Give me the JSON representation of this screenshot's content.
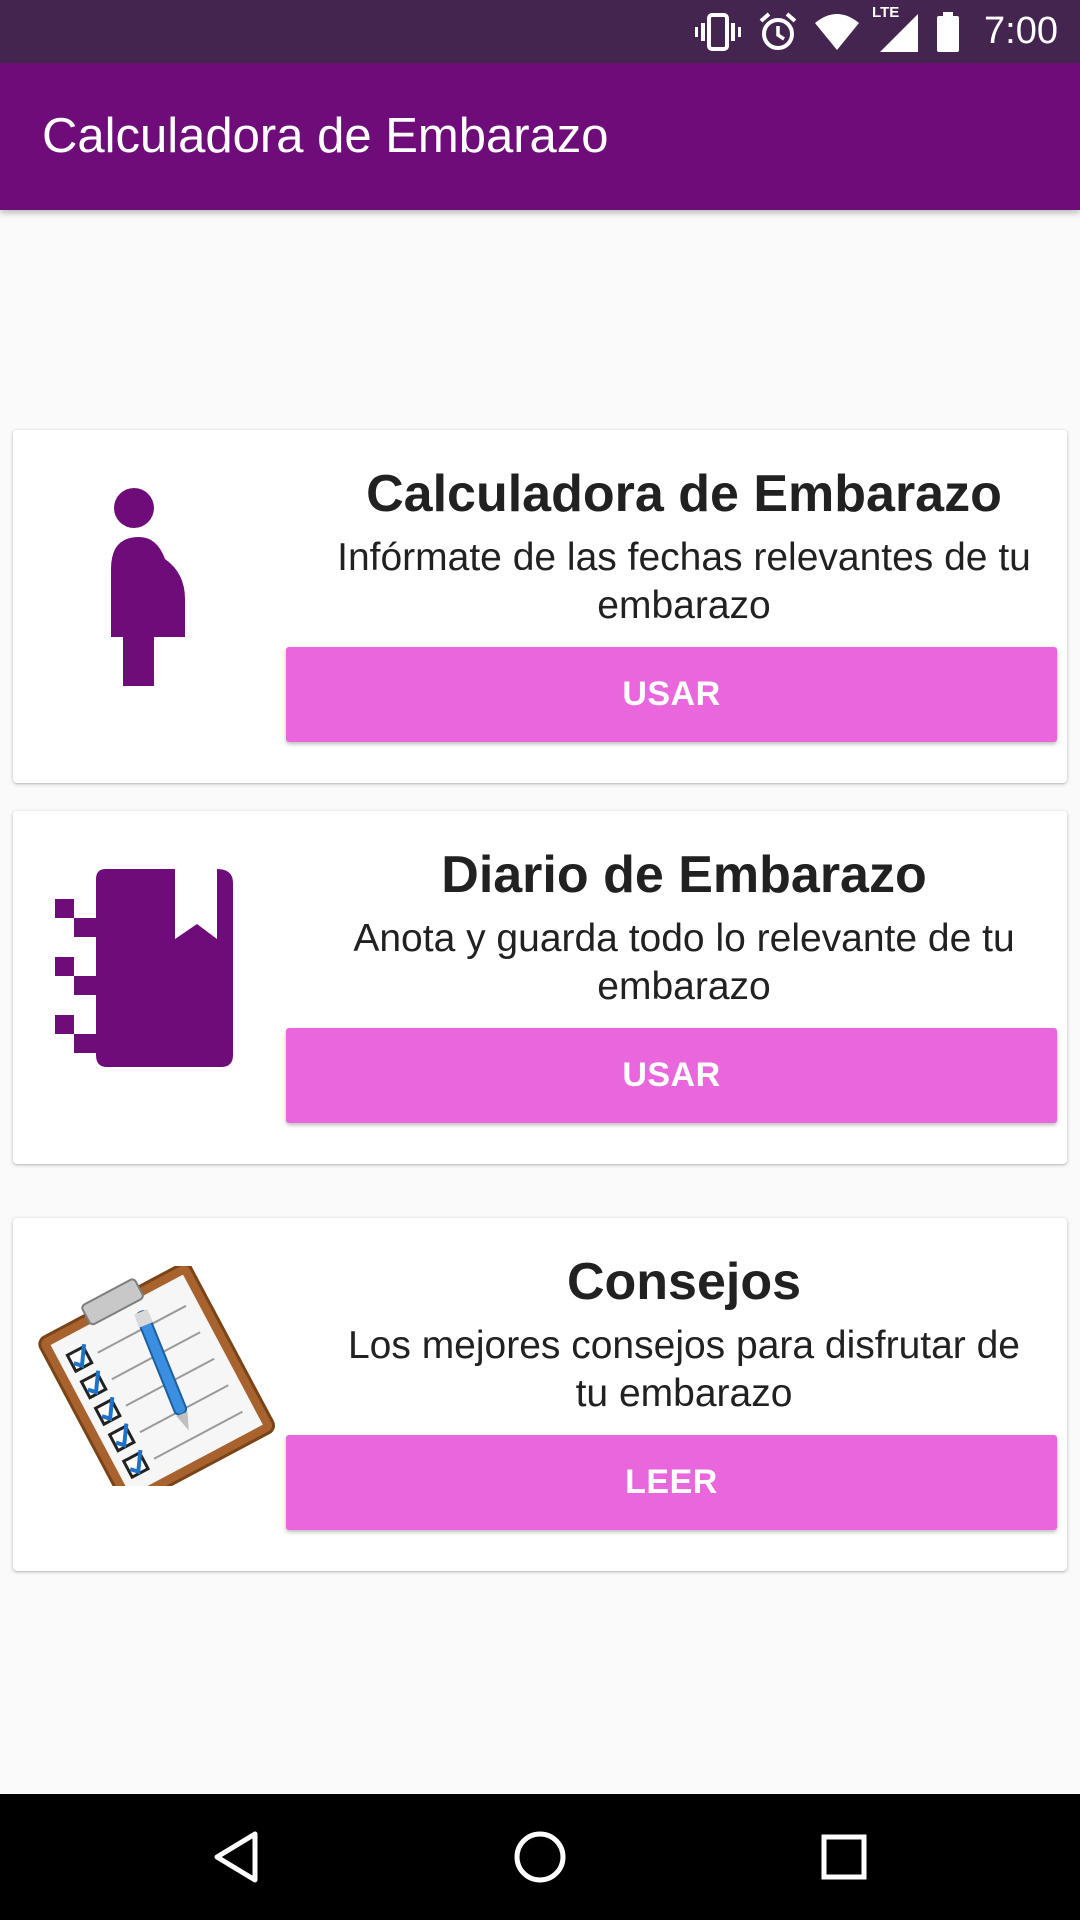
{
  "status_bar": {
    "time": "7:00",
    "network_label": "LTE",
    "icons": [
      "vibrate-icon",
      "alarm-icon",
      "wifi-icon",
      "lte-signal-icon",
      "battery-icon"
    ],
    "background": "#44254f"
  },
  "app_bar": {
    "title": "Calculadora de Embarazo",
    "background": "#6e0d79"
  },
  "cards": [
    {
      "icon": "pregnant-woman-icon",
      "title": "Calculadora de Embarazo",
      "description": "Infórmate de las fechas relevantes de tu embarazo",
      "button_label": "USAR"
    },
    {
      "icon": "diary-notebook-icon",
      "title": "Diario de Embarazo",
      "description": "Anota y guarda todo lo relevante de tu embarazo",
      "button_label": "USAR"
    },
    {
      "icon": "clipboard-checklist-icon",
      "title": "Consejos",
      "description": "Los mejores consejos para disfrutar de tu embarazo",
      "button_label": "LEER"
    }
  ],
  "colors": {
    "accent_button": "#e966dc",
    "icon_purple": "#6e0d79"
  },
  "nav_bar": {
    "buttons": [
      "back-icon",
      "home-icon",
      "recents-icon"
    ]
  }
}
